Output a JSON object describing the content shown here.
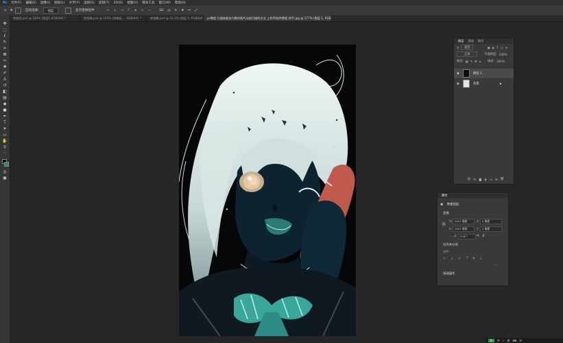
{
  "menu": [
    "文件(F)",
    "编辑(E)",
    "图像(I)",
    "图层(L)",
    "文字(Y)",
    "选择(S)",
    "滤镜(T)",
    "3D(D)",
    "视图(V)",
    "增效工具",
    "窗口(W)",
    "帮助(H)"
  ],
  "options": {
    "auto_select_label": "自动选择:",
    "auto_select_value": "图层",
    "transform_label": "显示变换控件"
  },
  "tabs": [
    {
      "label": "转曲图.psd @ 100% (图层1,RGB/8#) *",
      "active": false
    },
    {
      "label": "转线稿.psd @ 100% (线稿组..., RGB/8#) *",
      "active": false
    },
    {
      "label": "转描稿.psd @ 33.3% (图层 0, RGB/8#) *",
      "active": false
    },
    {
      "label": "ps教程 闪退修复技巧教你图片动态扫描的方法 上色PS软件教程 转手.jpg @ 177% (图层 1, RGB/8#) *",
      "active": true
    }
  ],
  "layers_panel": {
    "tabs": [
      "图层",
      "通道",
      "路径"
    ],
    "filter_label": "类型",
    "blend_mode": "正常",
    "opacity_label": "不透明度:",
    "opacity_value": "100%",
    "lock_label": "锁定:",
    "fill_label": "填充:",
    "fill_value": "100%",
    "layers": [
      {
        "name": "图层 1",
        "selected": true
      },
      {
        "name": "背景",
        "selected": false
      }
    ]
  },
  "properties_panel": {
    "title": "属性",
    "kind": "像素图层",
    "transform_title": "变换",
    "w_label": "W",
    "w_value": "3907 像素",
    "x_label": "X",
    "x_value": "0 像素",
    "h_label": "H",
    "h_value": "3907 像素",
    "y_label": "Y",
    "y_value": "0 像素",
    "angle_value": "0.00°",
    "align_title": "对齐并分布",
    "align_sub": "对齐:",
    "quick_title": "快速操作"
  },
  "taskbar": {
    "lang": "S",
    "items": [
      "中",
      "♪",
      "拼",
      "⌨",
      "☰"
    ]
  }
}
